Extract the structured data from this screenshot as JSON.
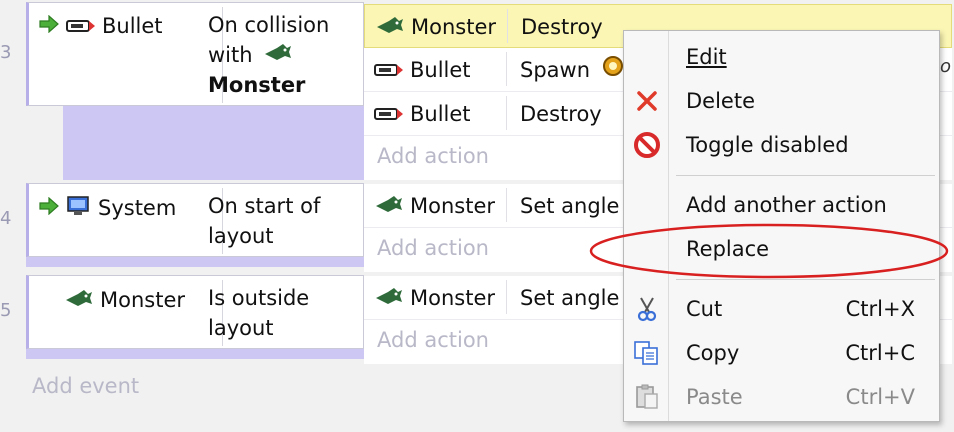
{
  "events": [
    {
      "number": "3",
      "object": "Bullet",
      "condition_lines": [
        "On collision",
        "with",
        "Monster"
      ],
      "actions": [
        {
          "object": "Monster",
          "name": "Destroy",
          "selected": true
        },
        {
          "object": "Bullet",
          "name": "Spawn"
        },
        {
          "object": "Bullet",
          "name": "Destroy"
        }
      ],
      "add_action": "Add action"
    },
    {
      "number": "4",
      "object": "System",
      "condition_lines": [
        "On start of",
        "layout"
      ],
      "actions": [
        {
          "object": "Monster",
          "name": "Set angle"
        }
      ],
      "add_action": "Add action"
    },
    {
      "number": "5",
      "object": "Monster",
      "condition_lines": [
        "Is outside",
        "layout"
      ],
      "actions": [
        {
          "object": "Monster",
          "name": "Set angle"
        }
      ],
      "add_action": "Add action"
    }
  ],
  "add_event": "Add event",
  "context_menu": {
    "items": [
      {
        "label": "Edit",
        "icon": "none"
      },
      {
        "label": "Delete",
        "icon": "x-icon"
      },
      {
        "label": "Toggle disabled",
        "icon": "no-entry-icon"
      },
      {
        "label": "Add another action",
        "icon": "none"
      },
      {
        "label": "Replace",
        "icon": "none",
        "highlighted_by_annotation": true
      },
      {
        "label": "Cut",
        "shortcut": "Ctrl+X",
        "icon": "scissors-icon"
      },
      {
        "label": "Copy",
        "shortcut": "Ctrl+C",
        "icon": "copy-icon"
      },
      {
        "label": "Paste",
        "shortcut": "Ctrl+V",
        "icon": "paste-icon",
        "disabled": true
      }
    ]
  },
  "colors": {
    "selection": "#fbf6b4",
    "condition_bar": "#cdc8f3",
    "annotation_ellipse": "#d92020",
    "delete_icon": "#e03a2a",
    "add_text": "#b8b8c8"
  }
}
